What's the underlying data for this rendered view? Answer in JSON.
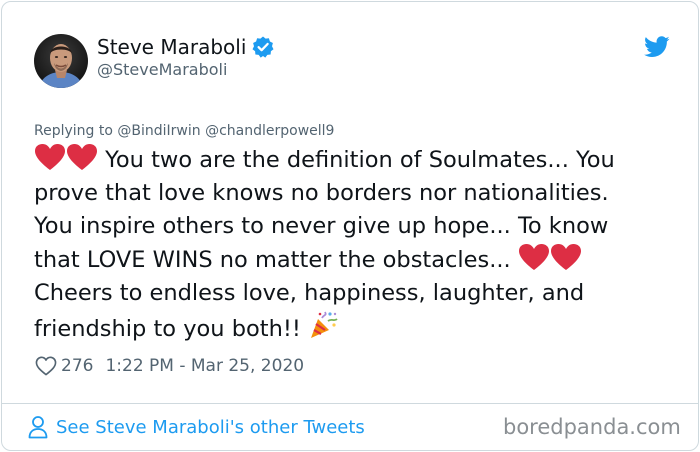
{
  "author": {
    "display_name": "Steve Maraboli",
    "handle": "@SteveMaraboli",
    "avatar": "avatar-photo",
    "verified_icon": "verified-badge-icon"
  },
  "brand_icon": "twitter-bird-icon",
  "reply": {
    "prefix": "Replying to",
    "mentions": "@BindiIrwin @chandlerpowell9"
  },
  "tweet": {
    "lines": [
      "You two are the definition of Soulmates... You",
      "prove that love knows no borders nor nationalities.",
      "You inspire others to never give up hope... To know",
      "that LOVE WINS no matter the obstacles...",
      "Cheers to endless love, happiness, laughter, and",
      "friendship to you both!!"
    ],
    "emojis": [
      "red-heart-emoji",
      "red-heart-emoji",
      "party-popper-emoji"
    ]
  },
  "meta": {
    "likes": "276",
    "timestamp": "1:22 PM - Mar 25, 2020"
  },
  "footer": {
    "see_more": "See Steve Maraboli's other Tweets"
  },
  "watermark": "boredpanda.com",
  "colors": {
    "link": "#1d9bf0",
    "text": "#0f1419",
    "secondary": "#536471",
    "border": "#cfd9de",
    "heart_emoji": "#dd2e44"
  }
}
